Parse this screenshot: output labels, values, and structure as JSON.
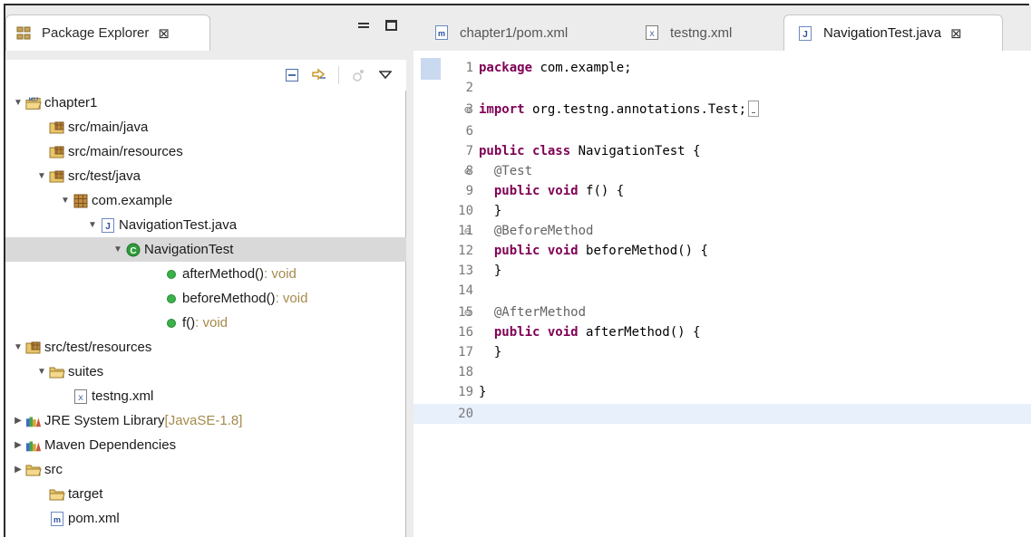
{
  "package_explorer": {
    "title": "Package Explorer",
    "tree": [
      {
        "label": "chapter1",
        "suffix": "",
        "icon": "maven-project-icon",
        "twisty": "open",
        "indent": 0
      },
      {
        "label": "src/main/java",
        "suffix": "",
        "icon": "source-folder-icon",
        "twisty": "none",
        "indent": 1
      },
      {
        "label": "src/main/resources",
        "suffix": "",
        "icon": "source-folder-icon",
        "twisty": "none",
        "indent": 1
      },
      {
        "label": "src/test/java",
        "suffix": "",
        "icon": "source-folder-icon",
        "twisty": "open",
        "indent": 1
      },
      {
        "label": "com.example",
        "suffix": "",
        "icon": "package-icon",
        "twisty": "open",
        "indent": 2
      },
      {
        "label": "NavigationTest.java",
        "suffix": "",
        "icon": "java-file-icon",
        "twisty": "open",
        "indent": 3
      },
      {
        "label": "NavigationTest",
        "suffix": "",
        "icon": "class-icon",
        "twisty": "open",
        "indent": 4,
        "selected": true
      },
      {
        "label": "afterMethod()",
        "suffix": " : void",
        "icon": "public-method-icon",
        "twisty": "none",
        "indent": 5
      },
      {
        "label": "beforeMethod()",
        "suffix": " : void",
        "icon": "public-method-icon",
        "twisty": "none",
        "indent": 5
      },
      {
        "label": "f()",
        "suffix": " : void",
        "icon": "public-method-icon",
        "twisty": "none",
        "indent": 5
      },
      {
        "label": "src/test/resources",
        "suffix": "",
        "icon": "source-folder-icon",
        "twisty": "open",
        "indent": 0
      },
      {
        "label": "suites",
        "suffix": "",
        "icon": "folder-icon",
        "twisty": "open",
        "indent": 1
      },
      {
        "label": "testng.xml",
        "suffix": "",
        "icon": "xml-file-icon",
        "twisty": "none",
        "indent": 2
      },
      {
        "label": "JRE System Library",
        "suffix": " [JavaSE-1.8]",
        "icon": "library-icon",
        "twisty": "closed",
        "indent": 0
      },
      {
        "label": "Maven Dependencies",
        "suffix": "",
        "icon": "library-icon",
        "twisty": "closed",
        "indent": 0
      },
      {
        "label": "src",
        "suffix": "",
        "icon": "folder-icon",
        "twisty": "closed",
        "indent": 0
      },
      {
        "label": "target",
        "suffix": "",
        "icon": "folder-icon",
        "twisty": "none",
        "indent": 1
      },
      {
        "label": "pom.xml",
        "suffix": "",
        "icon": "maven-file-icon",
        "twisty": "none",
        "indent": 1
      }
    ]
  },
  "editor": {
    "tabs": [
      {
        "label": "chapter1/pom.xml",
        "icon": "maven-file-icon",
        "active": false
      },
      {
        "label": "testng.xml",
        "icon": "xml-file-icon",
        "active": false
      },
      {
        "label": "NavigationTest.java",
        "icon": "java-file-icon",
        "active": true
      }
    ],
    "lines": [
      {
        "n": "1",
        "fold": "",
        "code": "package com.example;"
      },
      {
        "n": "2",
        "fold": "",
        "code": ""
      },
      {
        "n": "3",
        "fold": "⊕",
        "code": "import org.testng.annotations.Test;"
      },
      {
        "n": "6",
        "fold": "",
        "code": ""
      },
      {
        "n": "7",
        "fold": "",
        "code": "public class NavigationTest {"
      },
      {
        "n": "8",
        "fold": "⊖",
        "code": "  @Test"
      },
      {
        "n": "9",
        "fold": "",
        "code": "  public void f() {"
      },
      {
        "n": "10",
        "fold": "",
        "code": "  }"
      },
      {
        "n": "11",
        "fold": "⊖",
        "code": "  @BeforeMethod"
      },
      {
        "n": "12",
        "fold": "",
        "code": "  public void beforeMethod() {"
      },
      {
        "n": "13",
        "fold": "",
        "code": "  }"
      },
      {
        "n": "14",
        "fold": "",
        "code": ""
      },
      {
        "n": "15",
        "fold": "⊖",
        "code": "  @AfterMethod"
      },
      {
        "n": "16",
        "fold": "",
        "code": "  public void afterMethod() {"
      },
      {
        "n": "17",
        "fold": "",
        "code": "  }"
      },
      {
        "n": "18",
        "fold": "",
        "code": ""
      },
      {
        "n": "19",
        "fold": "",
        "code": "}"
      },
      {
        "n": "20",
        "fold": "",
        "code": ""
      }
    ]
  },
  "colors": {
    "keyword": "#7f0055",
    "annotation": "#646464",
    "selection": "#d9d9d9",
    "current_line": "#e8f0fb",
    "method_public": "#3bb14a",
    "class_icon": "#2e9d3a"
  }
}
